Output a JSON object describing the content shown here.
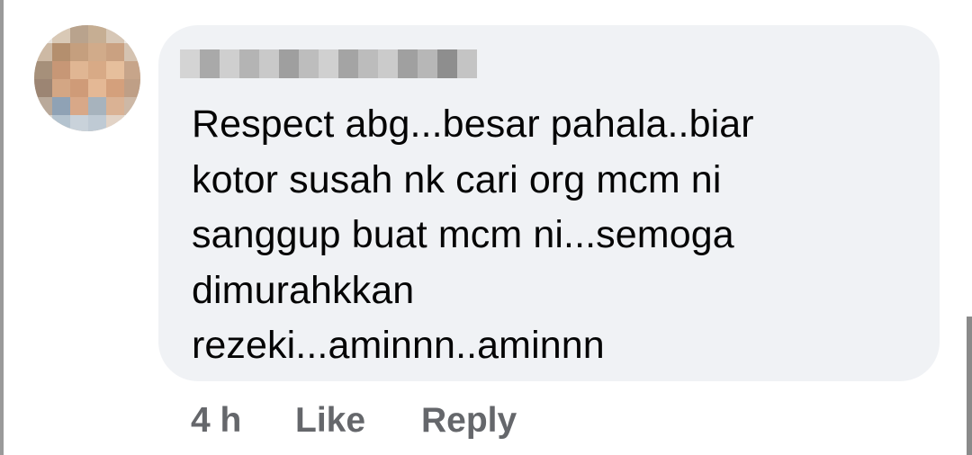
{
  "comment": {
    "author_name": "",
    "text_lines": [
      "Respect abg...besar pahala..biar",
      "kotor susah nk cari org mcm ni",
      "sanggup buat mcm ni...semoga",
      "dimurahkkan",
      "rezeki...aminnn..aminnn"
    ],
    "avatar_icon": "blurred-profile-avatar",
    "bubble_color": "#f0f2f5"
  },
  "actions": {
    "time": "4 h",
    "like_label": "Like",
    "reply_label": "Reply",
    "color": "#65676b"
  }
}
